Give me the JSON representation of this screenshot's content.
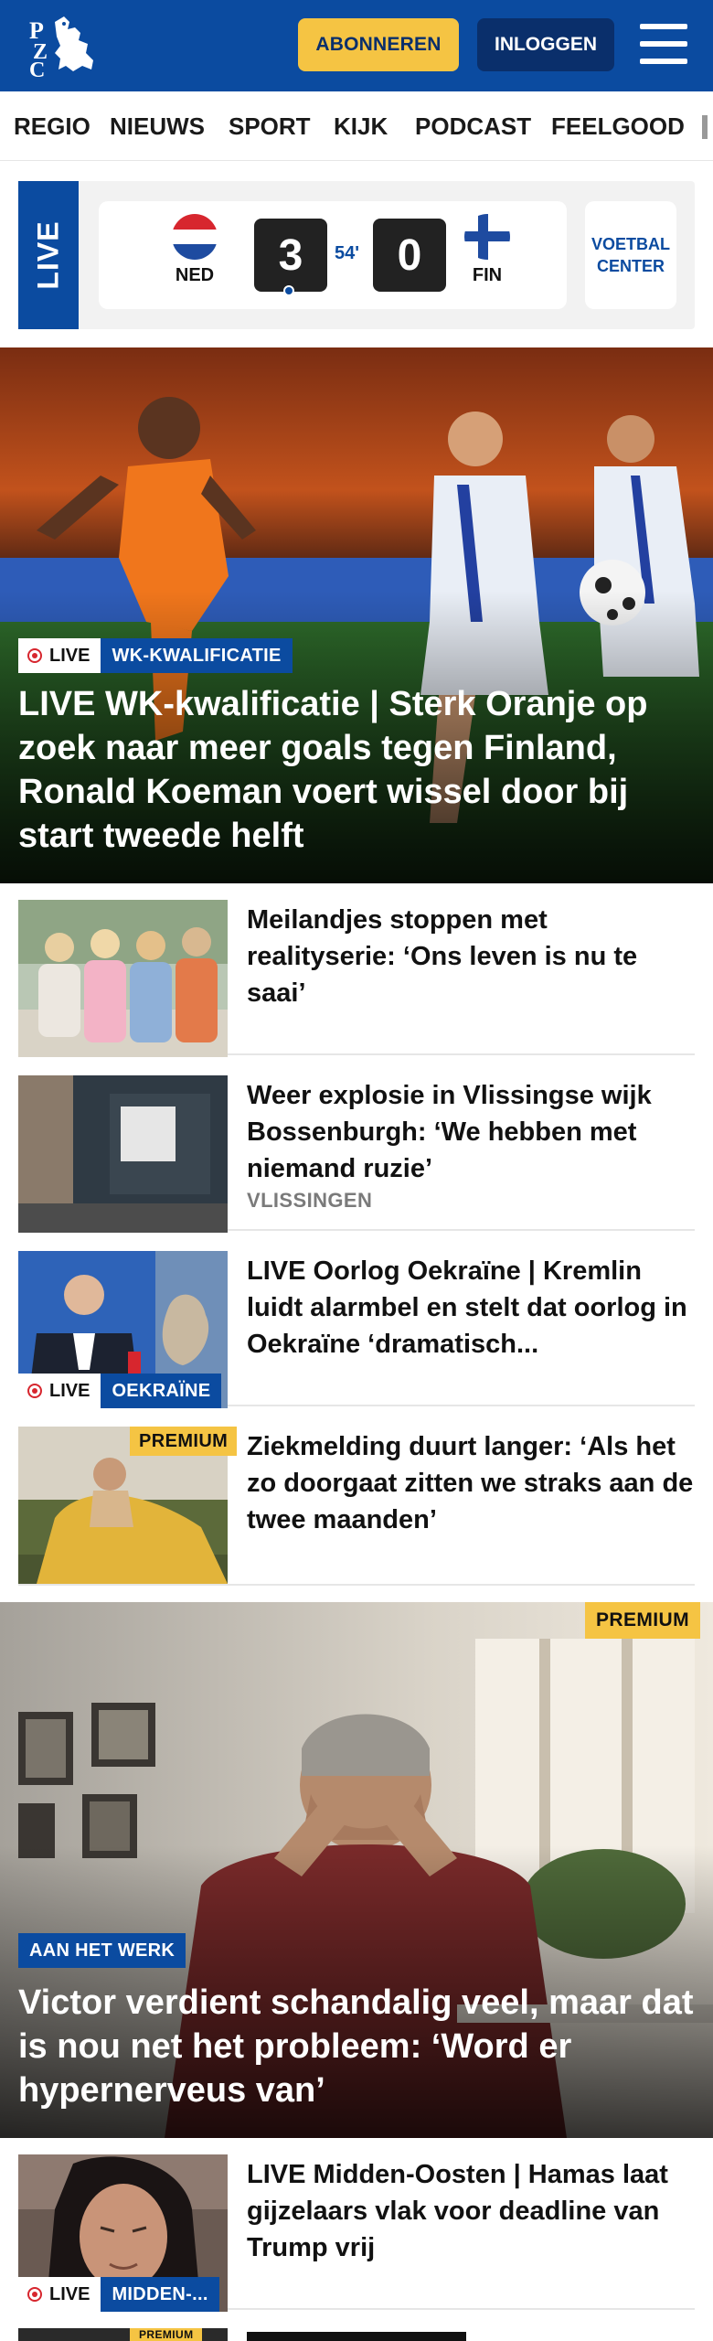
{
  "header": {
    "logo_text": "PZC",
    "subscribe_label": "ABONNEREN",
    "login_label": "INLOGGEN",
    "colors": {
      "brand": "#0b4ba0",
      "accent": "#f5c443",
      "dark": "#0a2f6b"
    }
  },
  "nav": {
    "items": [
      "REGIO",
      "NIEUWS",
      "SPORT",
      "KIJK",
      "PODCAST",
      "FEELGOOD"
    ]
  },
  "live_score": {
    "live_label": "LIVE",
    "home_code": "NED",
    "home_score": "3",
    "away_code": "FIN",
    "away_score": "0",
    "minute": "54'",
    "center_label": "VOETBAL CENTER"
  },
  "hero": {
    "live_label": "LIVE",
    "category": "WK-KWALIFICATIE",
    "title": "LIVE WK-kwalificatie | Sterk Oranje op zoek naar meer goals tegen Finland, Ronald Koeman voert wissel door bij start tweede helft"
  },
  "articles": [
    {
      "title": "Meilandjes stoppen met realityserie: ‘Ons leven is nu te saai’"
    },
    {
      "title": "Weer explosie in Vlissingse wijk Bossenburgh: ‘We hebben met niemand ruzie’",
      "subtitle": "VLISSINGEN"
    },
    {
      "title": "LIVE Oorlog Oekraïne | Kremlin luidt alarmbel en stelt dat oorlog in Oekraïne ‘dramatisch...",
      "live_label": "LIVE",
      "category": "OEKRAÏNE"
    },
    {
      "title": "Ziekmelding duurt langer: ‘Als het zo doorgaat zitten we straks aan de twee maanden’",
      "badge": "PREMIUM"
    }
  ],
  "hero2": {
    "badge": "PREMIUM",
    "category": "AAN HET WERK",
    "title": "Victor verdient schandalig veel, maar dat is nou net het probleem: ‘Word er hypernerveus van’"
  },
  "articles2": [
    {
      "title": "LIVE Midden-Oosten | Hamas laat gijzelaars vlak voor deadline van Trump vrij",
      "live_label": "LIVE",
      "category": "MIDDEN-..."
    },
    {
      "badge": "PREMIUM"
    }
  ]
}
